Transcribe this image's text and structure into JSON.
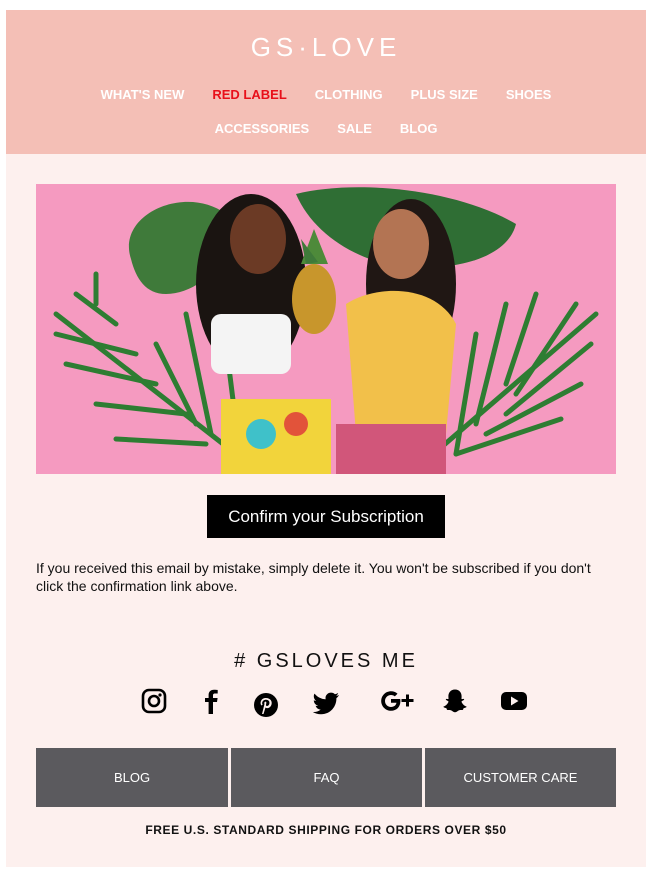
{
  "header": {
    "logo": "GS·LOVE",
    "nav_row1": [
      "WHAT'S NEW",
      "RED LABEL",
      "CLOTHING",
      "PLUS SIZE",
      "SHOES"
    ],
    "nav_row2": [
      "ACCESSORIES",
      "SALE",
      "BLOG"
    ],
    "highlight_color": "#e8101a",
    "background_color": "#f4bfb6"
  },
  "hero": {
    "background_color": "#f59ac0"
  },
  "cta": {
    "label": "Confirm your Subscription"
  },
  "notice": {
    "text": "If you received this email by mistake, simply delete it. You won't be subscribed if you don't click the confirmation link above."
  },
  "social": {
    "hashtag": "# GSLOVES ME",
    "icons": [
      "instagram-icon",
      "facebook-icon",
      "pinterest-icon",
      "twitter-icon",
      "google-plus-icon",
      "snapchat-icon",
      "youtube-icon"
    ]
  },
  "footer": {
    "links": [
      "BLOG",
      "FAQ",
      "CUSTOMER CARE"
    ],
    "shipping": "FREE U.S. STANDARD SHIPPING FOR ORDERS OVER $50"
  }
}
